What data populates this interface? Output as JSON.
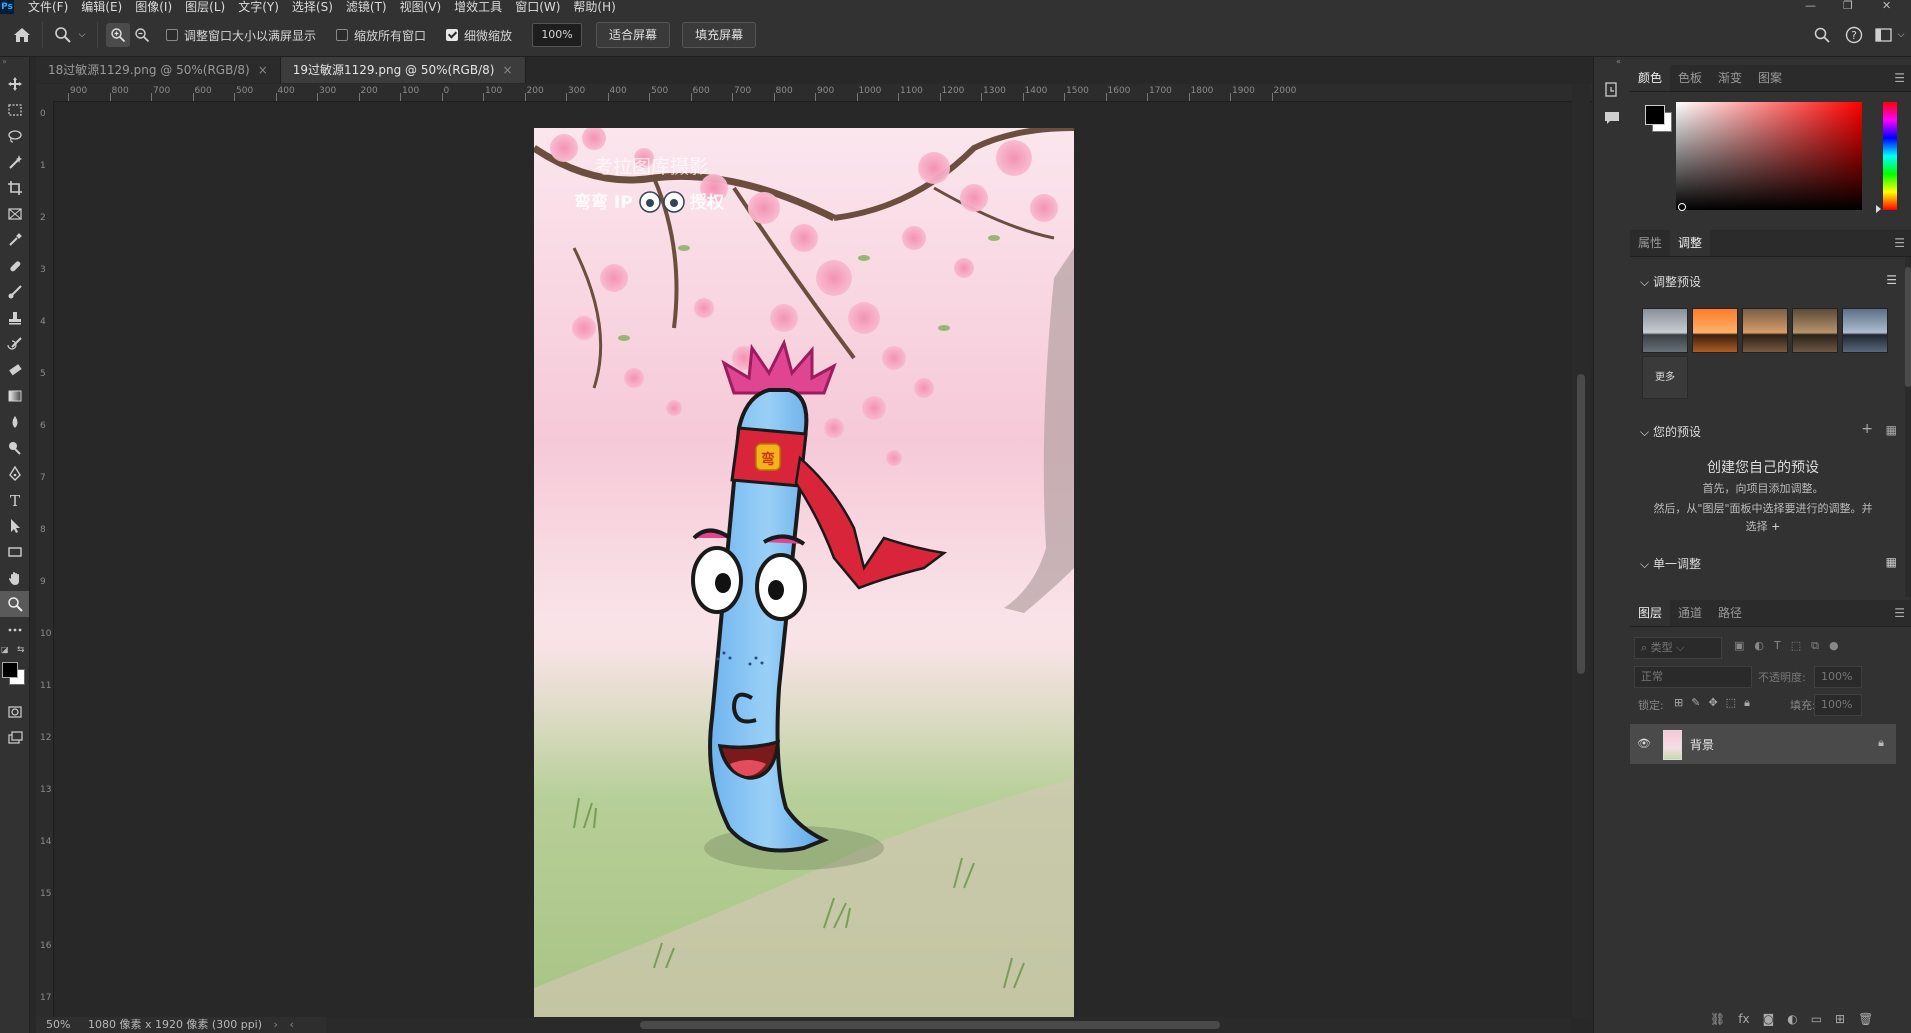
{
  "menubar": {
    "logo": "Ps",
    "items": [
      "文件(F)",
      "编辑(E)",
      "图像(I)",
      "图层(L)",
      "文字(Y)",
      "选择(S)",
      "滤镜(T)",
      "视图(V)",
      "增效工具",
      "窗口(W)",
      "帮助(H)"
    ]
  },
  "options": {
    "chk_resize": "调整窗口大小以满屏显示",
    "chk_all": "缩放所有窗口",
    "chk_scrubby": "细微缩放",
    "zoom_value": "100%",
    "fit_screen": "适合屏幕",
    "fill_screen": "填充屏幕"
  },
  "tabs": [
    {
      "label": "18过敏源1129.png @ 50%(RGB/8)",
      "active": false
    },
    {
      "label": "19过敏源1129.png @ 50%(RGB/8)",
      "active": true
    }
  ],
  "ruler_labels": [
    "900",
    "800",
    "700",
    "600",
    "500",
    "400",
    "300",
    "200",
    "100",
    "0",
    "100",
    "200",
    "300",
    "400",
    "500",
    "600",
    "700",
    "800",
    "900",
    "1000",
    "1100",
    "1200",
    "1300",
    "1400",
    "1500",
    "1600",
    "1700",
    "1800",
    "1900",
    "2000"
  ],
  "ruler_left_labels": [
    "0",
    "1",
    "2",
    "3",
    "4",
    "5",
    "6",
    "7",
    "8",
    "9",
    "10",
    "11",
    "12",
    "13",
    "14",
    "15",
    "16",
    "17"
  ],
  "canvas": {
    "watermark_top": "考拉图库摄影",
    "watermark_bottom": "弯弯 IP",
    "watermark_suffix": "授权",
    "badge_glyph": "弯"
  },
  "status": {
    "zoom": "50%",
    "doc_info": "1080 像素 x 1920 像素 (300 ppi)"
  },
  "colors": {
    "accent": "#31a8ff",
    "bg_panel": "#323232",
    "canvas_bg": "#282828"
  },
  "panels": {
    "color_tabs": [
      "颜色",
      "色板",
      "渐变",
      "图案"
    ],
    "adjust_tabs": [
      "属性",
      "调整"
    ],
    "adjust_presets": "调整预设",
    "more": "更多",
    "your_presets": "您的预设",
    "create_title": "创建您自己的预设",
    "create_line1": "首先，向项目添加调整。",
    "create_line2": "然后，从\"图层\"面板中选择要进行的调整。并",
    "create_line3": "选择",
    "single_adjust": "单一调整",
    "layer_tabs": [
      "图层",
      "通道",
      "路径"
    ],
    "filter_kind": "类型",
    "blend_mode": "正常",
    "opacity_label": "不透明度:",
    "opacity_value": "100%",
    "lock_label": "锁定:",
    "fill_label": "填充:",
    "fill_value": "100%",
    "layer_name": "背景"
  }
}
